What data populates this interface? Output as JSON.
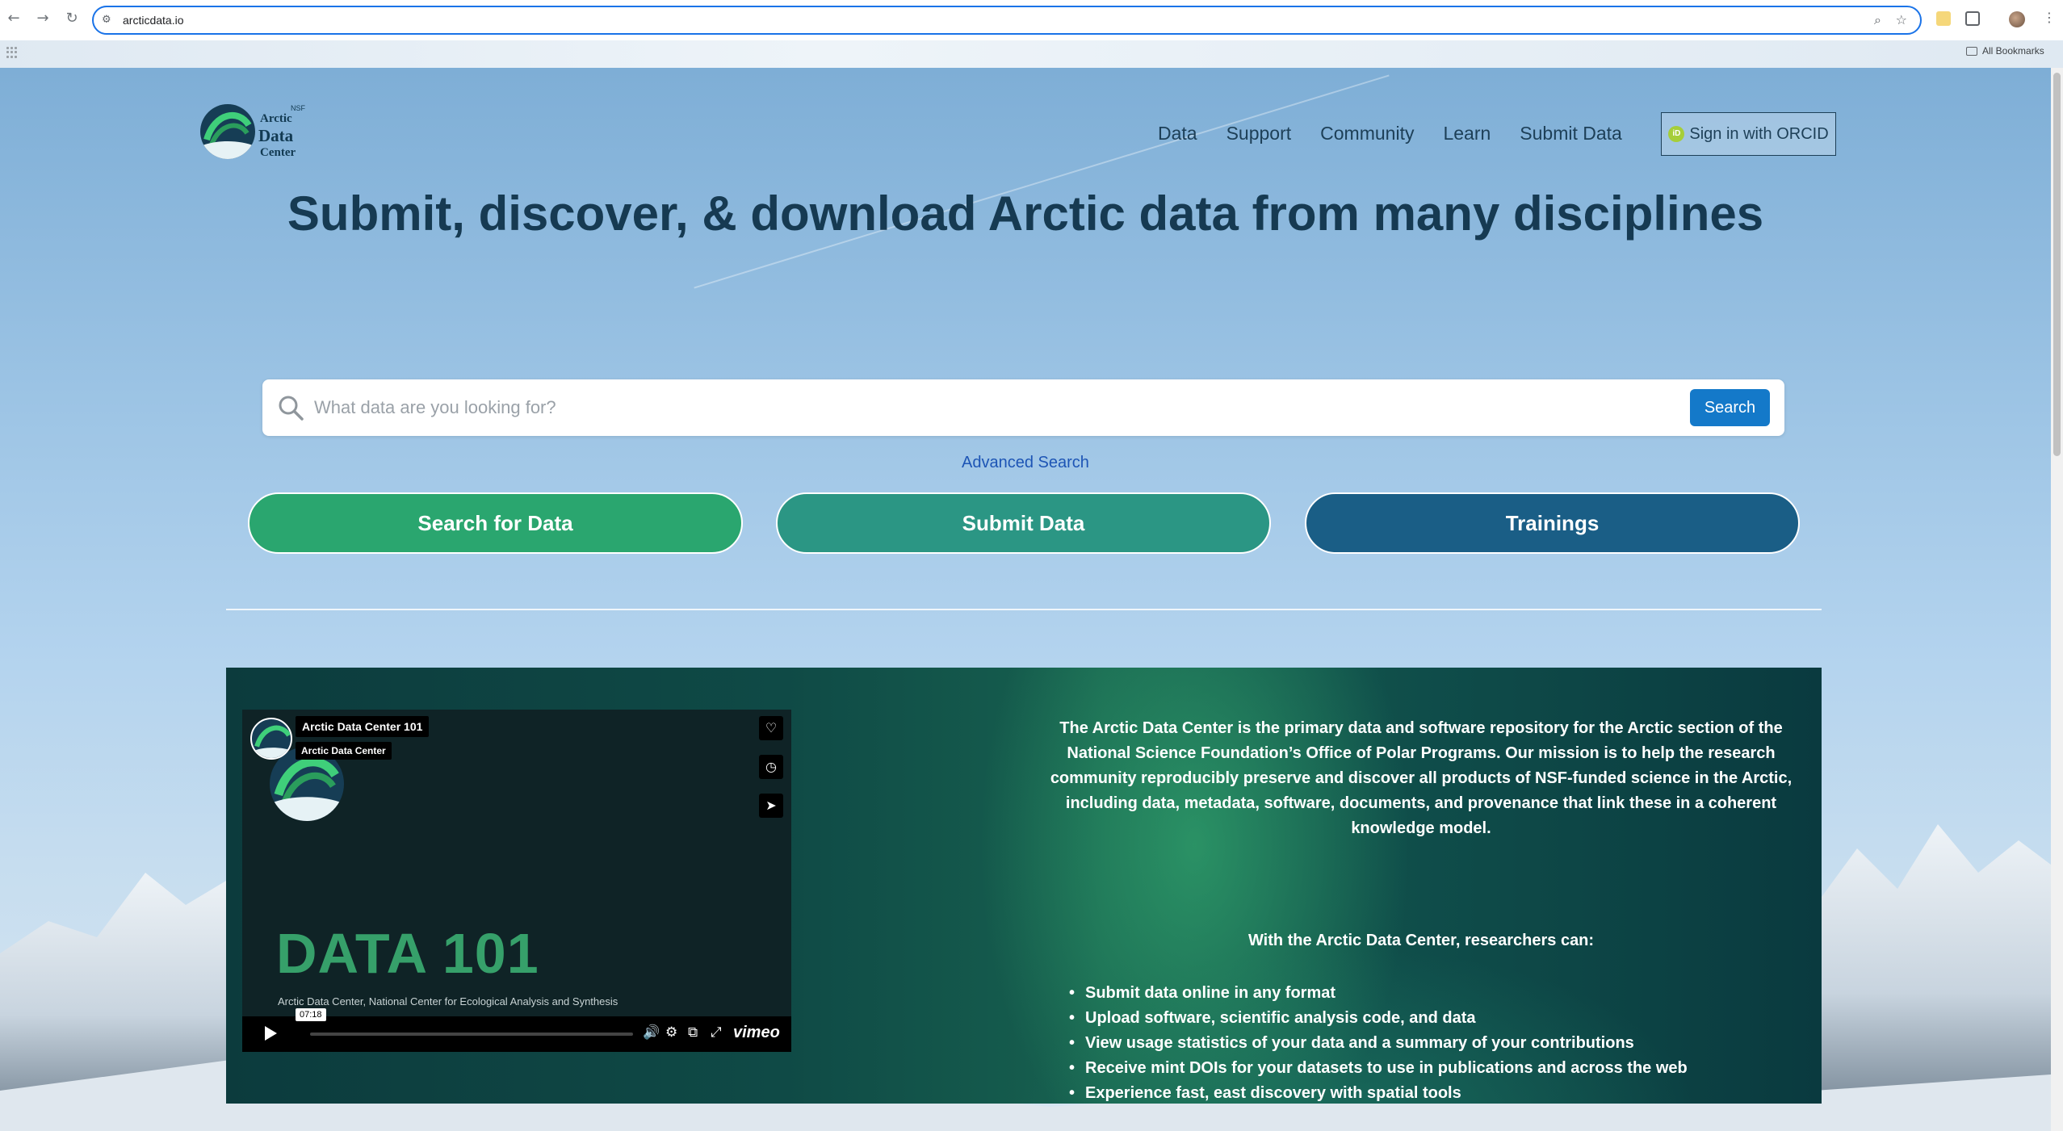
{
  "browser": {
    "url": "arcticdata.io",
    "bookmarks_label": "All Bookmarks"
  },
  "logo": {
    "nsf": "NSF",
    "line1": "Arctic",
    "line2": "Data",
    "line3": "Center"
  },
  "nav": {
    "items": [
      "Data",
      "Support",
      "Community",
      "Learn",
      "Submit Data"
    ],
    "signin_label": "Sign in with ORCID"
  },
  "hero": {
    "title": "Submit, discover, & download Arctic data from many disciplines"
  },
  "search": {
    "placeholder": "What data are you looking for?",
    "button_label": "Search",
    "advanced_label": "Advanced Search"
  },
  "cta": {
    "search_label": "Search for Data",
    "submit_label": "Submit Data",
    "trainings_label": "Trainings"
  },
  "video": {
    "title": "Arctic Data Center 101",
    "channel": "Arctic Data Center",
    "big_title": "DATA 101",
    "caption": "Arctic Data Center, National Center for Ecological Analysis and Synthesis",
    "duration": "07:18",
    "brand": "vimeo"
  },
  "about": {
    "paragraph": "The Arctic Data Center is the primary data and software repository for the Arctic section of the National Science Foundation’s Office of Polar Programs. Our mission is to help the research community reproducibly preserve and discover all products of NSF-funded science in the Arctic, including data, metadata, software, documents, and provenance that link these in a coherent knowledge model.",
    "heading": "With the Arctic Data Center, researchers can:",
    "bullets": [
      "Submit data online in any format",
      "Upload software, scientific analysis code, and data",
      "View usage statistics of your data and a summary of your contributions",
      "Receive mint DOIs for your datasets to use in publications and across the web",
      "Experience fast, east discovery with spatial tools"
    ]
  },
  "colors": {
    "accent_green": "#2aa66f",
    "accent_teal": "#2b9684",
    "accent_navy": "#1a5e86",
    "search_blue": "#1479c9",
    "title_navy": "#163a52"
  }
}
